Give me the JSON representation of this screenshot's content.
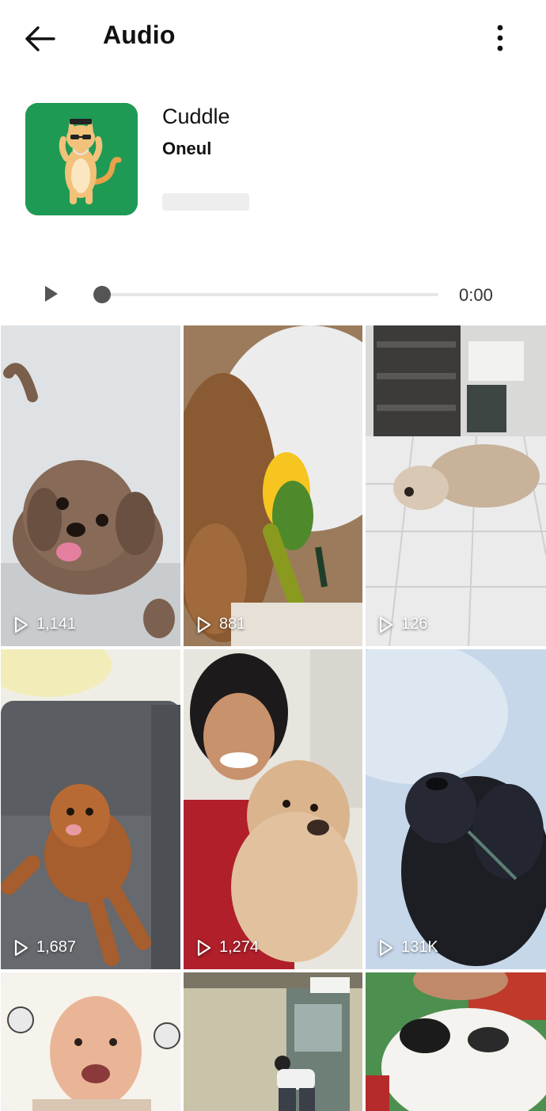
{
  "header": {
    "title": "Audio",
    "back_icon": "arrow-left-icon",
    "menu_icon": "more-vertical-icon"
  },
  "audio": {
    "title": "Cuddle",
    "artist": "Oneul",
    "cover_color": "#1f9a55"
  },
  "player": {
    "time": "0:00",
    "progress": 0
  },
  "videos": [
    {
      "views": "1,141",
      "subject": "dog"
    },
    {
      "views": "881",
      "subject": "parrot"
    },
    {
      "views": "126",
      "subject": "dog"
    },
    {
      "views": "1,687",
      "subject": "poodle"
    },
    {
      "views": "1,274",
      "subject": "girl-with-dog"
    },
    {
      "views": "131K",
      "subject": "dog-in-snow"
    },
    {
      "views": "",
      "subject": "baby"
    },
    {
      "views": "",
      "subject": "man-with-dog"
    },
    {
      "views": "",
      "subject": "puppy"
    }
  ]
}
